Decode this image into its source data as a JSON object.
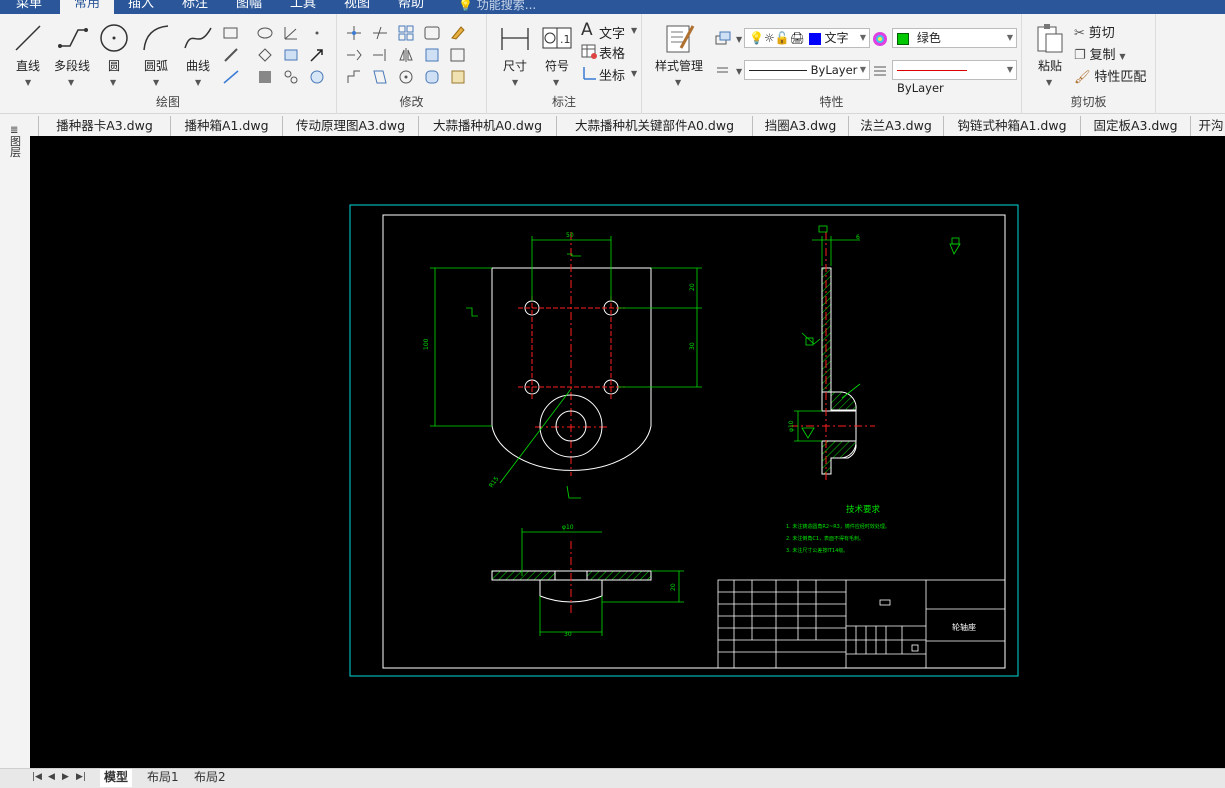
{
  "menubar": {
    "items": [
      "菜单",
      "常用",
      "插入",
      "标注",
      "图幅",
      "工具",
      "视图",
      "帮助"
    ],
    "active": "常用",
    "search_placeholder": "功能搜索..."
  },
  "ribbon": {
    "draw": {
      "label": "绘图",
      "tools": [
        "直线",
        "多段线",
        "圆",
        "圆弧",
        "曲线"
      ]
    },
    "modify": {
      "label": "修改"
    },
    "annotate": {
      "label": "标注",
      "tools": [
        "尺寸",
        "符号"
      ],
      "small": [
        "文字",
        "表格",
        "坐标"
      ]
    },
    "properties": {
      "label": "特性",
      "style_manager": "样式管理",
      "text_style": "文字",
      "color": "绿色",
      "color_hex": "#00c800",
      "linetype": "ByLayer",
      "lineweight": "ByLayer"
    },
    "clipboard": {
      "label": "剪切板",
      "paste": "粘贴",
      "cut": "剪切",
      "copy": "复制",
      "match": "特性匹配"
    }
  },
  "doc_tabs": [
    "播种器卡A3.dwg",
    "播种箱A1.dwg",
    "传动原理图A3.dwg",
    "大蒜播种机A0.dwg",
    "大蒜播种机关键部件A0.dwg",
    "挡圈A3.dwg",
    "法兰A3.dwg",
    "钩链式种箱A1.dwg",
    "固定板A3.dwg",
    "开沟"
  ],
  "left_panel": "图层",
  "drawing": {
    "tech_title": "技术要求",
    "tech_notes": [
      "1. 未注铸造圆角R2~R3，铸件应经时效处理。",
      "2. 未注倒角C1，表面不得有毛刺。",
      "3. 未注尺寸公差按IT14级。"
    ],
    "part_name": "轮轴座",
    "dims": [
      "50",
      "100",
      "30",
      "20",
      "6",
      "φ10",
      "R15"
    ],
    "colors": {
      "border": "#ffffff",
      "frame": "#00ffff",
      "dim": "#00ff00",
      "center": "#ff0000",
      "hatch": "#00ff00",
      "text": "#00ff00"
    }
  },
  "layout_tabs": [
    "模型",
    "布局1",
    "布局2"
  ],
  "layout_active": "模型"
}
